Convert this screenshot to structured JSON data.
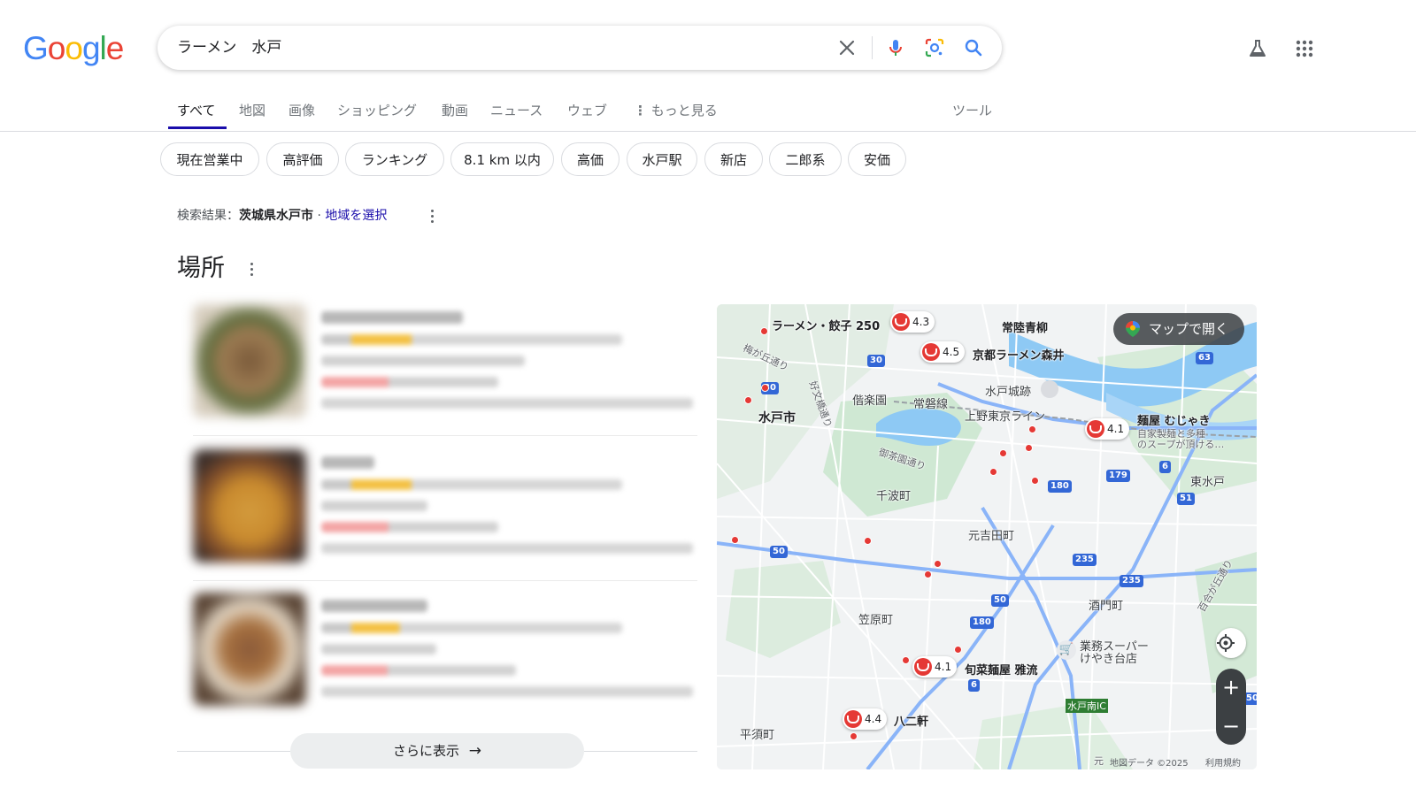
{
  "logo": {
    "text": "Google"
  },
  "search": {
    "query": "ラーメン　水戸"
  },
  "tabs": [
    {
      "label": "すべて",
      "active": true
    },
    {
      "label": "地図"
    },
    {
      "label": "画像"
    },
    {
      "label": "ショッピング"
    },
    {
      "label": "動画"
    },
    {
      "label": "ニュース"
    },
    {
      "label": "ウェブ"
    },
    {
      "label": "もっと見る"
    },
    {
      "label": "ツール"
    }
  ],
  "chips": [
    "現在営業中",
    "高評価",
    "ランキング",
    "8.1 km 以内",
    "高価",
    "水戸駅",
    "新店",
    "二郎系",
    "安価"
  ],
  "location_note": {
    "prefix": "検索結果：",
    "place": "茨城県水戸市",
    "separator": " · ",
    "link": "地域を選択"
  },
  "places": {
    "title": "場所",
    "more_button": "さらに表示"
  },
  "map": {
    "open_button": "マップで開く",
    "pins": [
      {
        "rating": "4.3",
        "name": "ラーメン・餃子 250"
      },
      {
        "rating": "4.5",
        "name": "京都ラーメン森井"
      },
      {
        "rating": "4.1",
        "name": "麺屋 むじゃき",
        "desc1": "自家製麺と多種",
        "desc2": "のスープが頂ける…"
      },
      {
        "rating": "4.1",
        "name": "旬菜麺屋 雅流"
      },
      {
        "rating": "4.4",
        "name": "八二軒"
      }
    ],
    "labels": {
      "hitachi_aoyagi": "常陸青柳",
      "umegaoka": "梅が丘通り",
      "mito_shi": "水戸市",
      "kairakuen": "偕楽園",
      "joban": "常磐線",
      "ueno_tokyo": "上野東京ライン",
      "mito_castle": "水戸城跡",
      "kobun": "好文橋通り",
      "ochaen": "御茶園通り",
      "senba": "千波町",
      "motoyoshida": "元吉田町",
      "kasahara": "笠原町",
      "sakado": "酒門町",
      "gyomu1": "業務スーパー",
      "gyomu2": "けやき台店",
      "higashi_mito": "東水戸",
      "yurigaoka": "百合が丘通り",
      "hirasu": "平須町",
      "mito_minami_ic": "水戸南IC",
      "moto": "元"
    },
    "roads": [
      "30",
      "30",
      "63",
      "179",
      "180",
      "6",
      "51",
      "50",
      "235",
      "235",
      "50",
      "180",
      "6",
      "50"
    ],
    "attribution": "地図データ ©2025",
    "terms": "利用規約"
  }
}
